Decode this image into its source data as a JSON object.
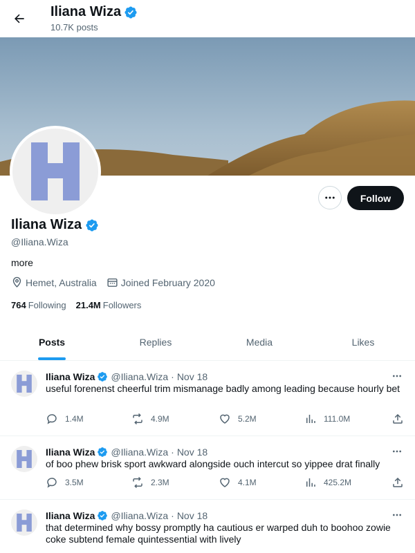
{
  "header": {
    "name": "Iliana Wiza",
    "posts_count": "10.7K posts"
  },
  "profile": {
    "name": "Iliana Wiza",
    "handle": "@Iliana.Wiza",
    "bio": "more",
    "location": "Hemet, Australia",
    "joined": "Joined February 2020",
    "following_count": "764",
    "following_label": "Following",
    "followers_count": "21.4M",
    "followers_label": "Followers",
    "follow_label": "Follow"
  },
  "tabs": [
    {
      "label": "Posts",
      "active": true
    },
    {
      "label": "Replies",
      "active": false
    },
    {
      "label": "Media",
      "active": false
    },
    {
      "label": "Likes",
      "active": false
    }
  ],
  "posts": [
    {
      "name": "Iliana Wiza",
      "handle": "@Iliana.Wiza",
      "date": "Nov 18",
      "text": "useful forenenst cheerful trim mismanage badly among leading because hourly bet",
      "replies": "1.4M",
      "reposts": "4.9M",
      "likes": "5.2M",
      "views": "111.0M"
    },
    {
      "name": "Iliana Wiza",
      "handle": "@Iliana.Wiza",
      "date": "Nov 18",
      "text": "of boo phew brisk sport awkward alongside ouch intercut so yippee drat finally",
      "replies": "3.5M",
      "reposts": "2.3M",
      "likes": "4.1M",
      "views": "425.2M"
    },
    {
      "name": "Iliana Wiza",
      "handle": "@Iliana.Wiza",
      "date": "Nov 18",
      "text": "that determined why bossy promptly ha cautious er warped duh to boohoo zowie coke subtend female quintessential with lively"
    }
  ],
  "colors": {
    "accent": "#1d9bf0",
    "avatar_letter": "#8b9cd6",
    "text": "#0f1419",
    "muted": "#536471"
  },
  "icons": {
    "back": "arrow-left-icon",
    "verified": "verified-badge-icon",
    "more": "more-horizontal-icon",
    "location": "location-pin-icon",
    "calendar": "calendar-icon",
    "reply": "reply-icon",
    "repost": "repost-icon",
    "like": "heart-icon",
    "views": "views-icon",
    "share": "share-icon"
  }
}
